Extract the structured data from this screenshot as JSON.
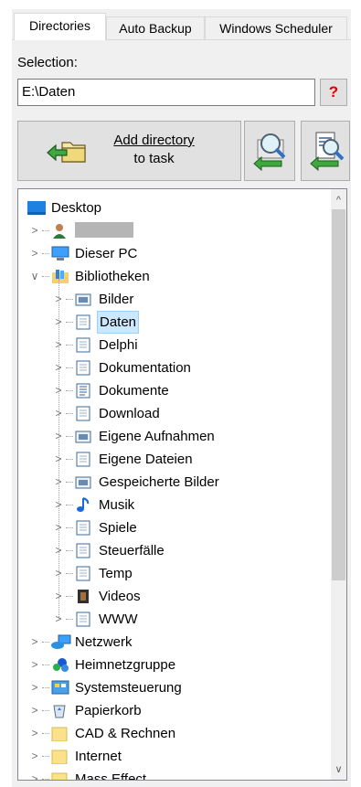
{
  "tabs": [
    {
      "label": "Directories",
      "active": true
    },
    {
      "label": "Auto Backup",
      "active": false
    },
    {
      "label": "Windows Scheduler",
      "active": false
    }
  ],
  "selection": {
    "label": "Selection:",
    "value": "E:\\Daten",
    "help_label": "?"
  },
  "add_button": {
    "line1": "Add directory",
    "line2": "to task"
  },
  "tree": {
    "root": "Desktop",
    "items": [
      {
        "label": "",
        "icon": "user-icon",
        "level": 1
      },
      {
        "label": "Dieser PC",
        "icon": "computer-icon",
        "level": 1
      },
      {
        "label": "Bibliotheken",
        "icon": "library-icon",
        "level": 1,
        "expanded": true
      },
      {
        "label": "Bilder",
        "icon": "pictures-library-icon",
        "level": 2
      },
      {
        "label": "Daten",
        "icon": "document-library-icon",
        "level": 2,
        "selected": true
      },
      {
        "label": "Delphi",
        "icon": "document-library-icon",
        "level": 2
      },
      {
        "label": "Dokumentation",
        "icon": "document-library-icon",
        "level": 2
      },
      {
        "label": "Dokumente",
        "icon": "documents-library-icon",
        "level": 2
      },
      {
        "label": "Download",
        "icon": "document-library-icon",
        "level": 2
      },
      {
        "label": "Eigene Aufnahmen",
        "icon": "pictures-library-icon",
        "level": 2
      },
      {
        "label": "Eigene Dateien",
        "icon": "document-library-icon",
        "level": 2
      },
      {
        "label": "Gespeicherte Bilder",
        "icon": "pictures-library-icon",
        "level": 2
      },
      {
        "label": "Musik",
        "icon": "music-library-icon",
        "level": 2
      },
      {
        "label": "Spiele",
        "icon": "document-library-icon",
        "level": 2
      },
      {
        "label": "Steuerfälle",
        "icon": "document-library-icon",
        "level": 2
      },
      {
        "label": "Temp",
        "icon": "document-library-icon",
        "level": 2
      },
      {
        "label": "Videos",
        "icon": "videos-library-icon",
        "level": 2
      },
      {
        "label": "WWW",
        "icon": "document-library-icon",
        "level": 2
      },
      {
        "label": "Netzwerk",
        "icon": "network-icon",
        "level": 1
      },
      {
        "label": "Heimnetzgruppe",
        "icon": "homegroup-icon",
        "level": 1
      },
      {
        "label": "Systemsteuerung",
        "icon": "control-panel-icon",
        "level": 1
      },
      {
        "label": "Papierkorb",
        "icon": "recycle-bin-icon",
        "level": 1
      },
      {
        "label": "CAD & Rechnen",
        "icon": "folder-icon",
        "level": 1
      },
      {
        "label": "Internet",
        "icon": "folder-icon",
        "level": 1
      },
      {
        "label": "Mass Effect",
        "icon": "folder-icon",
        "level": 1
      }
    ]
  },
  "colors": {
    "selection_bg": "#cce8ff",
    "selection_border": "#99d1ff",
    "help_red": "#e00000"
  }
}
